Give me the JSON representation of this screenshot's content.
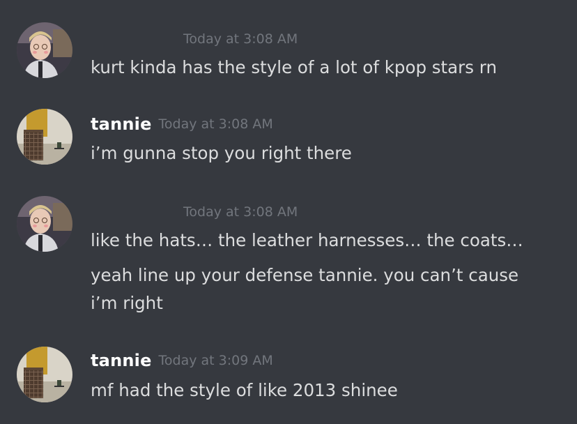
{
  "messages": [
    {
      "author": "",
      "avatar": "avatar-user-1",
      "timestamp": "Today at 3:08 AM",
      "lines": [
        "kurt kinda has the style of a lot of kpop stars rn"
      ]
    },
    {
      "author": "tannie",
      "avatar": "avatar-tannie",
      "timestamp": "Today at 3:08 AM",
      "lines": [
        "i’m gunna stop you right there"
      ]
    },
    {
      "author": "",
      "avatar": "avatar-user-1",
      "timestamp": "Today at 3:08 AM",
      "lines": [
        "like the hats… the leather harnesses… the coats…",
        "yeah line up your defense tannie. you can’t cause i’m right"
      ]
    },
    {
      "author": "tannie",
      "avatar": "avatar-tannie",
      "timestamp": "Today at 3:09 AM",
      "lines": [
        "mf had the style of like 2013 shinee"
      ]
    }
  ]
}
